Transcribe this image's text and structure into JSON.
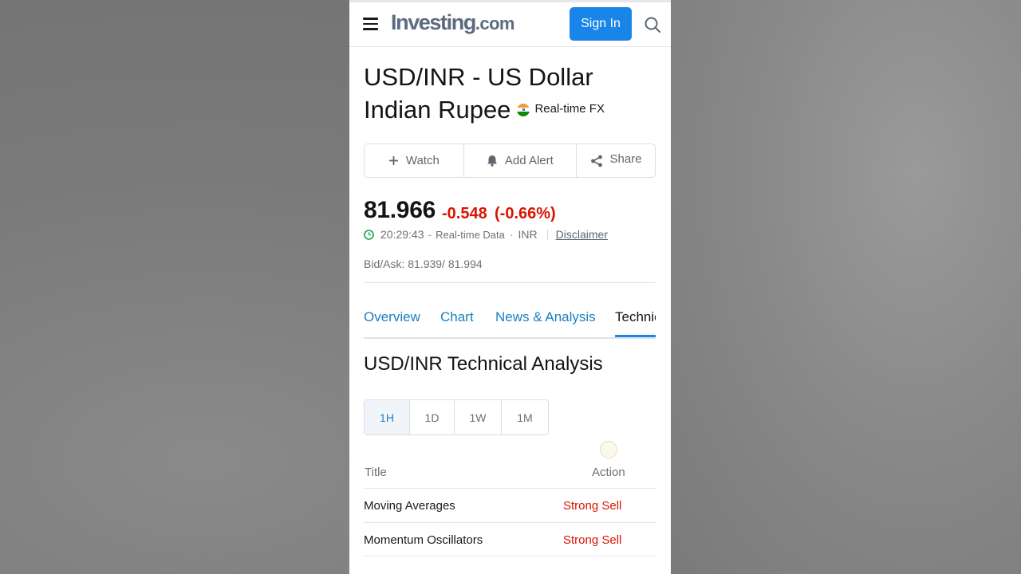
{
  "header": {
    "logo_main": "Investing",
    "logo_suffix": ".com",
    "signin_label": "Sign In"
  },
  "instrument": {
    "title_line1": "USD/INR - US Dollar",
    "title_line2": "Indian Rupee",
    "market_label": "Real-time FX"
  },
  "actions": {
    "watch": "Watch",
    "add_alert": "Add Alert",
    "share": "Share"
  },
  "quote": {
    "price": "81.966",
    "change": "-0.548",
    "change_pct": "(-0.66%)",
    "time": "20:29:43",
    "data_type": "Real-time Data",
    "currency": "INR",
    "disclaimer": "Disclaimer",
    "bid_ask": "Bid/Ask: 81.939/ 81.994"
  },
  "tabs": [
    {
      "label": "Overview"
    },
    {
      "label": "Chart"
    },
    {
      "label": "News & Analysis"
    },
    {
      "label": "Technical"
    }
  ],
  "technical": {
    "title": "USD/INR Technical Analysis",
    "periods": [
      {
        "label": "1H"
      },
      {
        "label": "1D"
      },
      {
        "label": "1W"
      },
      {
        "label": "1M"
      }
    ],
    "active_period": "1H",
    "columns": {
      "title": "Title",
      "action": "Action"
    },
    "rows": [
      {
        "title": "Moving Averages",
        "action": "Strong Sell"
      },
      {
        "title": "Momentum Oscillators",
        "action": "Strong Sell"
      }
    ]
  },
  "colors": {
    "accent": "#1a85e8",
    "negative": "#d91400",
    "link": "#1a7fc0"
  }
}
